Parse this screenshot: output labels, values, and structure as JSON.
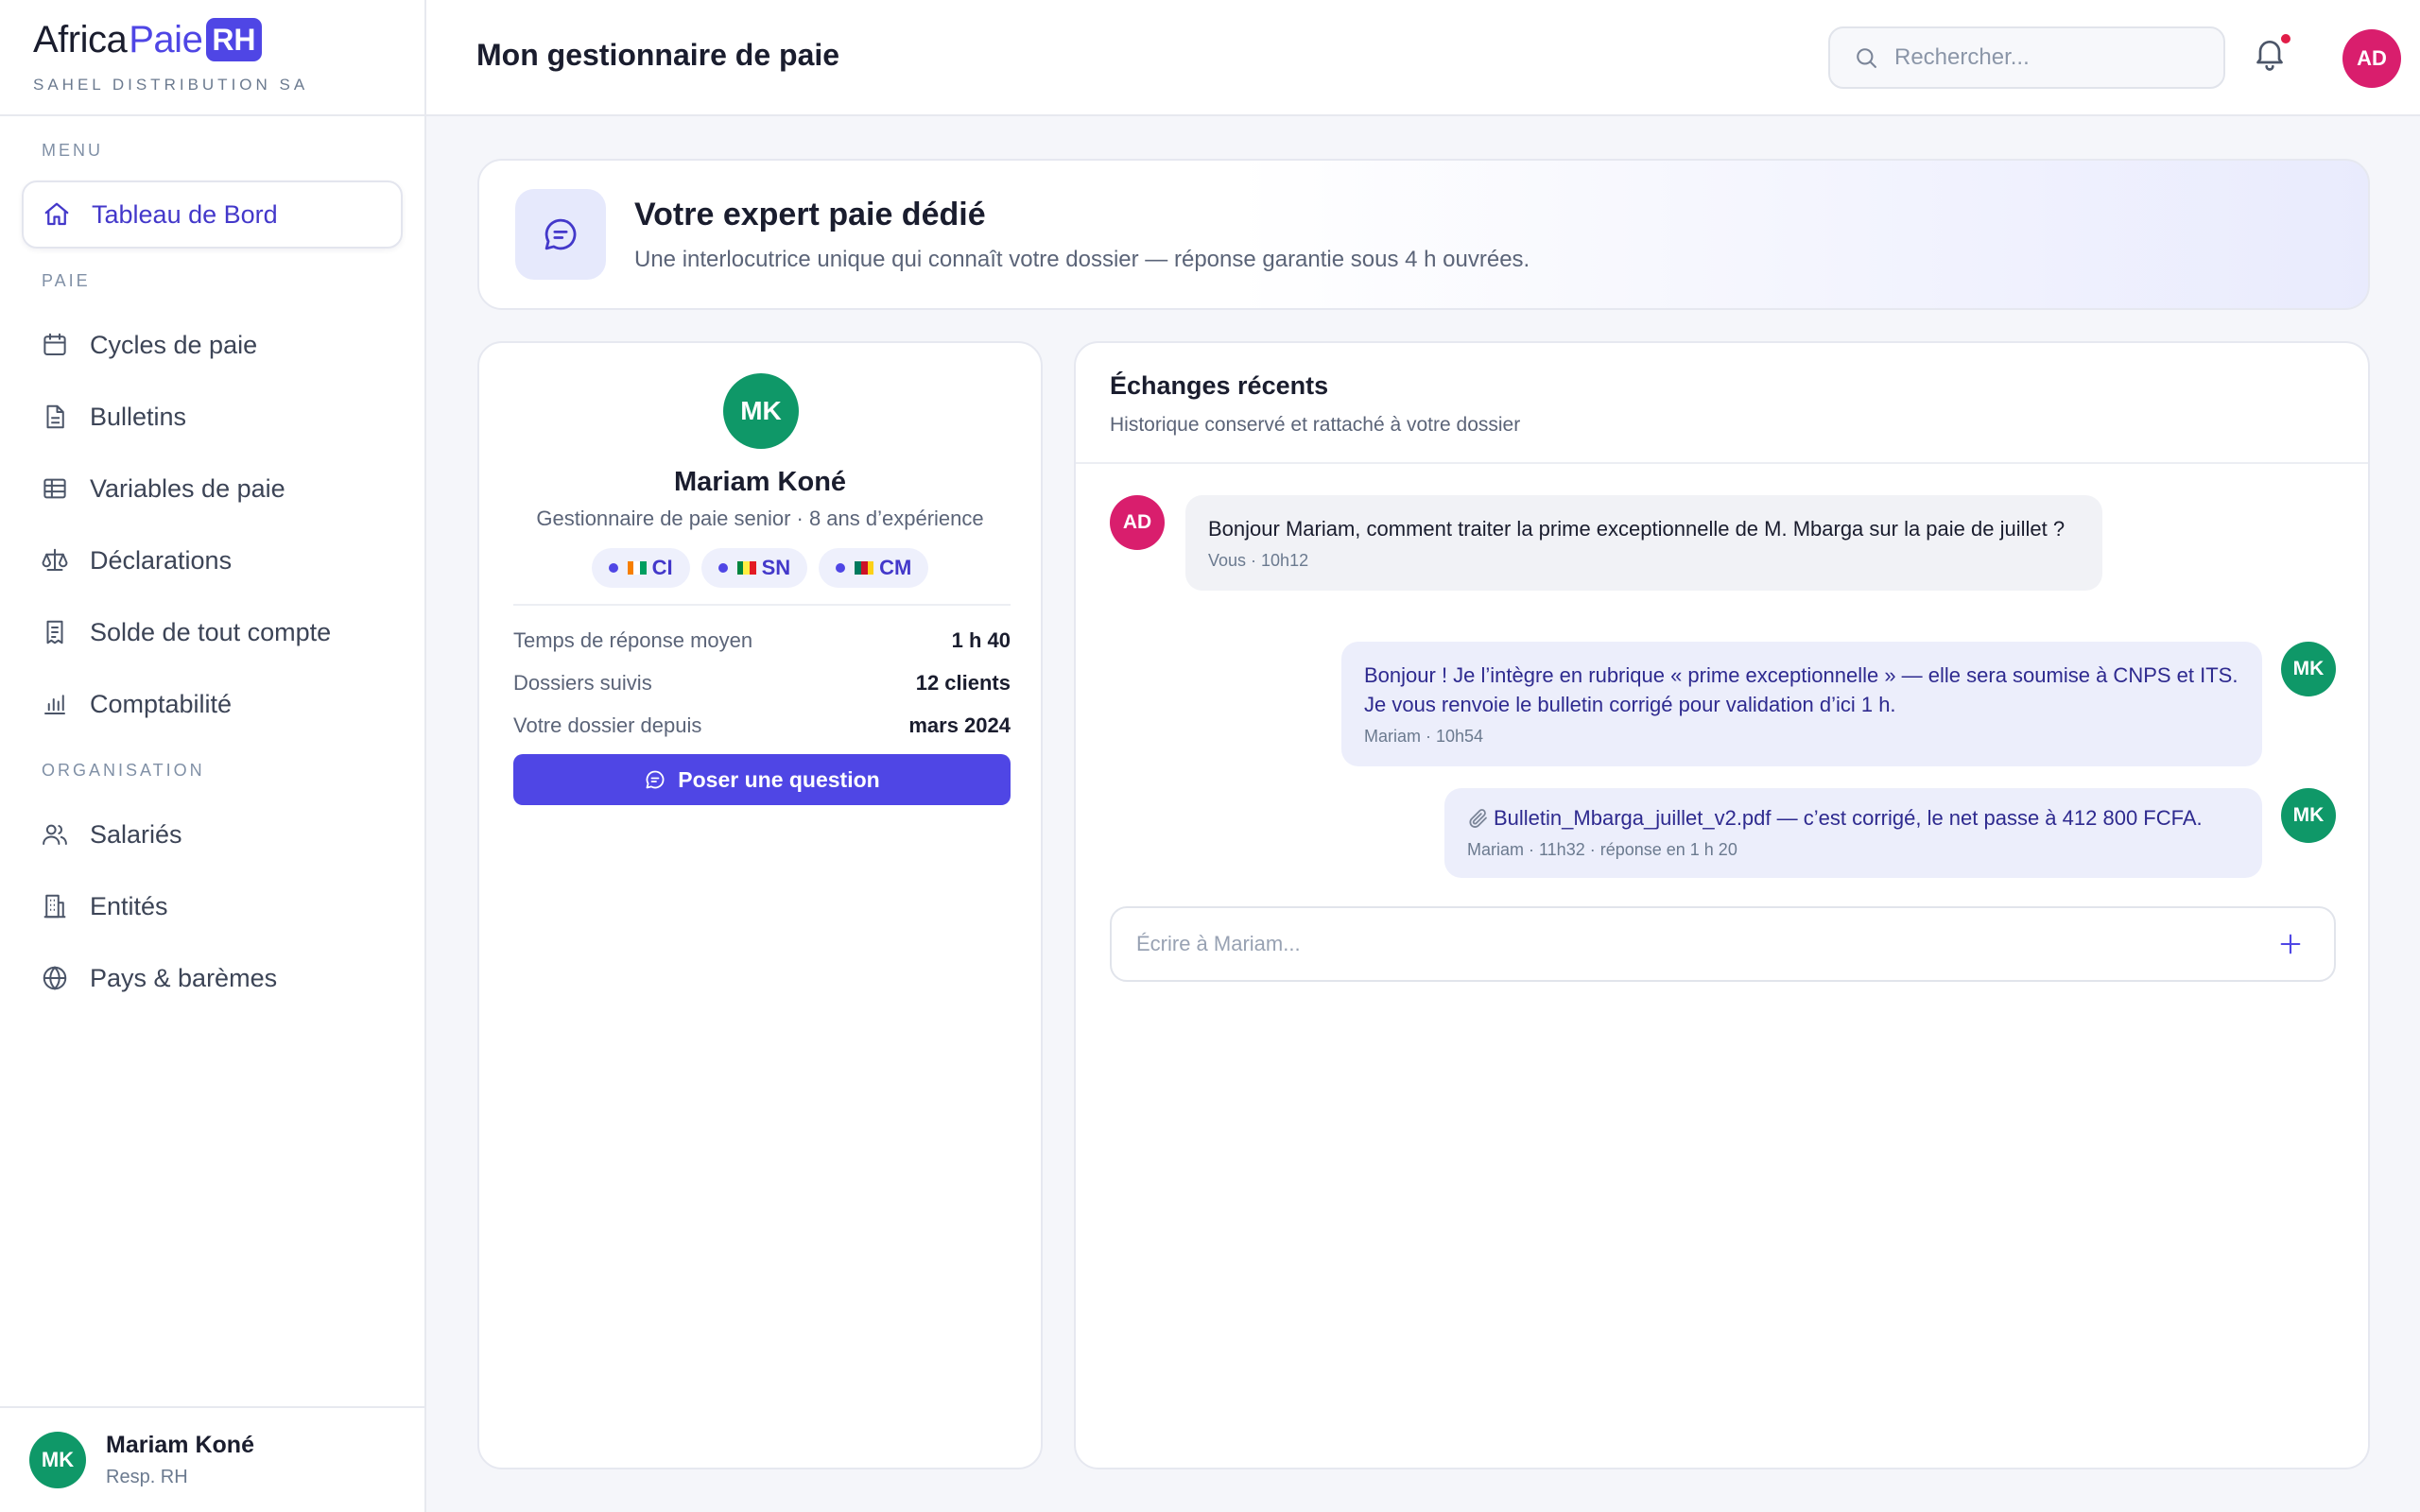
{
  "brand": {
    "name_part1": "Africa",
    "name_part2": "Paie",
    "name_badge": "RH",
    "company": "SAHEL DISTRIBUTION SA",
    "accent_color": "#4f46e5"
  },
  "sidebar": {
    "menu_label": "MENU",
    "dashboard": {
      "label": "Tableau de Bord",
      "icon": "home-icon"
    },
    "paie_label": "PAIE",
    "paie_items": [
      {
        "label": "Cycles de paie",
        "icon": "calendar-icon"
      },
      {
        "label": "Bulletins",
        "icon": "document-icon"
      },
      {
        "label": "Variables de paie",
        "icon": "table-icon"
      },
      {
        "label": "Déclarations",
        "icon": "scale-icon"
      },
      {
        "label": "Solde de tout compte",
        "icon": "receipt-icon"
      },
      {
        "label": "Comptabilité",
        "icon": "bar-chart-icon"
      }
    ],
    "org_label": "ORGANISATION",
    "org_items": [
      {
        "label": "Salariés",
        "icon": "users-icon"
      },
      {
        "label": "Entités",
        "icon": "building-icon"
      },
      {
        "label": "Pays & barèmes",
        "icon": "globe-icon"
      }
    ],
    "user": {
      "initials": "MK",
      "name": "Mariam Koné",
      "role": "Resp. RH"
    }
  },
  "topbar": {
    "title": "Mon gestionnaire de paie",
    "search_placeholder": "Rechercher...",
    "user_initials": "AD"
  },
  "hero": {
    "title": "Votre expert paie dédié",
    "subtitle": "Une interlocutrice unique qui connaît votre dossier — réponse garantie sous 4 h ouvrées."
  },
  "profile": {
    "initials": "MK",
    "name": "Mariam Koné",
    "role": "Gestionnaire de paie senior · 8 ans d’expérience",
    "countries": [
      "CI",
      "SN",
      "CM"
    ],
    "stats": [
      {
        "label": "Temps de réponse moyen",
        "value": "1 h 40"
      },
      {
        "label": "Dossiers suivis",
        "value": "12 clients"
      },
      {
        "label": "Votre dossier depuis",
        "value": "mars 2024"
      }
    ],
    "ask_button": "Poser une question"
  },
  "chat": {
    "title": "Échanges récents",
    "subtitle": "Historique conservé et rattaché à votre dossier",
    "messages": [
      {
        "initials": "AD",
        "text": "Bonjour Mariam, comment traiter la prime exceptionnelle de M. Mbarga sur la paie de juillet ?",
        "meta": "Vous · 10h12"
      },
      {
        "initials": "MK",
        "text": "Bonjour ! Je l’intègre en rubrique « prime exceptionnelle » — elle sera soumise à CNPS et ITS. Je vous renvoie le bulletin corrigé pour validation d’ici 1 h.",
        "meta": "Mariam · 10h54"
      },
      {
        "initials": "MK",
        "text": "Bulletin_Mbarga_juillet_v2.pdf — c’est corrigé, le net passe à 412 800 FCFA.",
        "meta": "Mariam · 11h32 · réponse en 1 h 20"
      }
    ],
    "composer_placeholder": "Écrire à Mariam..."
  }
}
